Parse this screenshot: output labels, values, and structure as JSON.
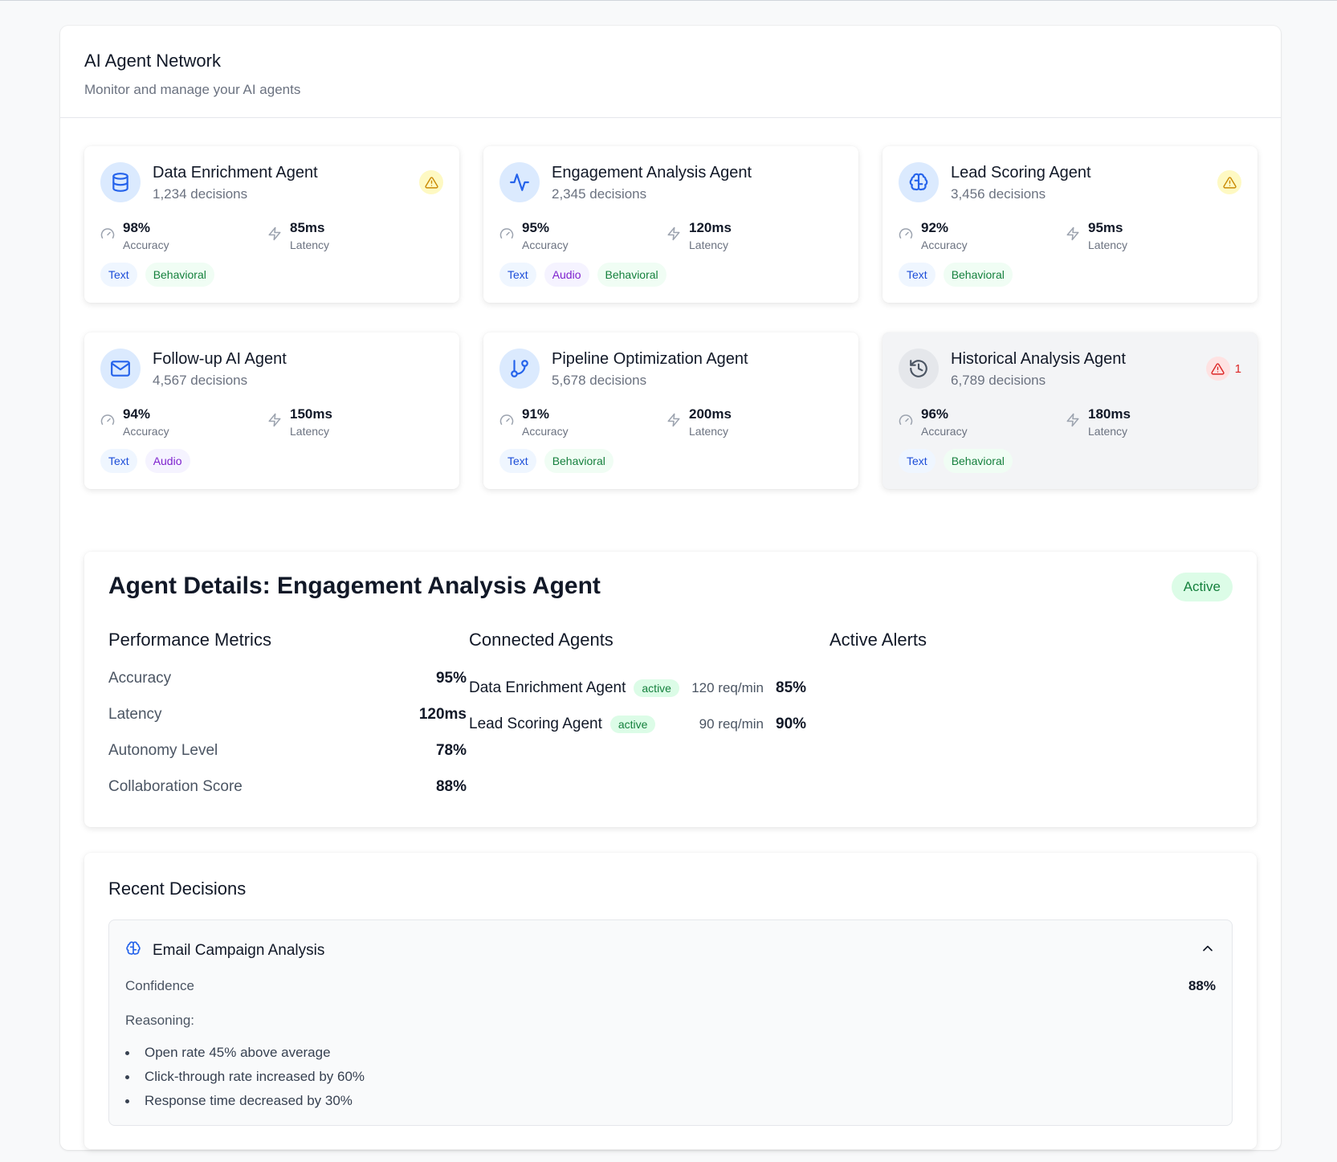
{
  "header": {
    "title": "AI Agent Network",
    "subtitle": "Monitor and manage your AI agents"
  },
  "colors": {
    "accent": "#2563eb",
    "warning": "#ca8a04",
    "danger": "#dc2626",
    "success": "#15803d"
  },
  "agents": [
    {
      "name": "Data Enrichment Agent",
      "decisions": "1,234 decisions",
      "icon": "database-icon",
      "accuracy": "98%",
      "accuracy_label": "Accuracy",
      "latency": "85ms",
      "latency_label": "Latency",
      "tags": [
        "Text",
        "Behavioral"
      ],
      "status": "warning"
    },
    {
      "name": "Engagement Analysis Agent",
      "decisions": "2,345 decisions",
      "icon": "activity-icon",
      "accuracy": "95%",
      "accuracy_label": "Accuracy",
      "latency": "120ms",
      "latency_label": "Latency",
      "tags": [
        "Text",
        "Audio",
        "Behavioral"
      ],
      "status": "ok"
    },
    {
      "name": "Lead Scoring Agent",
      "decisions": "3,456 decisions",
      "icon": "brain-icon",
      "accuracy": "92%",
      "accuracy_label": "Accuracy",
      "latency": "95ms",
      "latency_label": "Latency",
      "tags": [
        "Text",
        "Behavioral"
      ],
      "status": "warning"
    },
    {
      "name": "Follow-up AI Agent",
      "decisions": "4,567 decisions",
      "icon": "mail-icon",
      "accuracy": "94%",
      "accuracy_label": "Accuracy",
      "latency": "150ms",
      "latency_label": "Latency",
      "tags": [
        "Text",
        "Audio"
      ],
      "status": "ok"
    },
    {
      "name": "Pipeline Optimization Agent",
      "decisions": "5,678 decisions",
      "icon": "git-branch-icon",
      "accuracy": "91%",
      "accuracy_label": "Accuracy",
      "latency": "200ms",
      "latency_label": "Latency",
      "tags": [
        "Text",
        "Behavioral"
      ],
      "status": "ok"
    },
    {
      "name": "Historical Analysis Agent",
      "decisions": "6,789 decisions",
      "icon": "history-icon",
      "accuracy": "96%",
      "accuracy_label": "Accuracy",
      "latency": "180ms",
      "latency_label": "Latency",
      "tags": [
        "Text",
        "Behavioral"
      ],
      "status": "alert",
      "alert_count": "1"
    }
  ],
  "details": {
    "title": "Agent Details: Engagement Analysis Agent",
    "status": "Active",
    "performance_heading": "Performance Metrics",
    "performance": [
      {
        "label": "Accuracy",
        "value": "95%"
      },
      {
        "label": "Latency",
        "value": "120ms"
      },
      {
        "label": "Autonomy Level",
        "value": "78%"
      },
      {
        "label": "Collaboration Score",
        "value": "88%"
      }
    ],
    "connected_heading": "Connected Agents",
    "connected": [
      {
        "name": "Data Enrichment Agent",
        "status": "active",
        "rate": "120 req/min",
        "percent": "85%"
      },
      {
        "name": "Lead Scoring Agent",
        "status": "active",
        "rate": "90 req/min",
        "percent": "90%"
      }
    ],
    "alerts_heading": "Active Alerts"
  },
  "recent": {
    "heading": "Recent Decisions",
    "decision": {
      "title": "Email Campaign Analysis",
      "confidence_label": "Confidence",
      "confidence_value": "88%",
      "reasoning_label": "Reasoning:",
      "reasons": [
        "Open rate 45% above average",
        "Click-through rate increased by 60%",
        "Response time decreased by 30%"
      ]
    }
  }
}
